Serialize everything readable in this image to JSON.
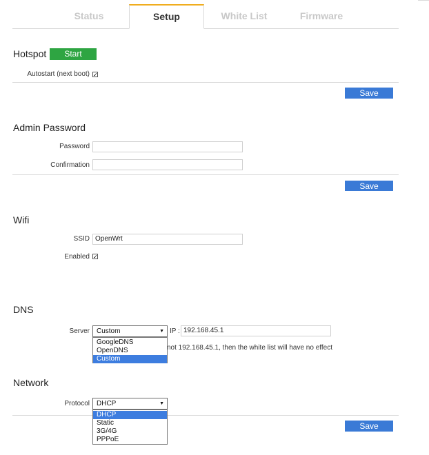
{
  "tabs": [
    {
      "label": "Status",
      "active": false
    },
    {
      "label": "Setup",
      "active": true
    },
    {
      "label": "White List",
      "active": false
    },
    {
      "label": "Firmware",
      "active": false
    }
  ],
  "hotspot": {
    "title": "Hotspot",
    "start_label": "Start",
    "autostart_label": "Autostart (next boot)",
    "autostart_checked": true,
    "save_label": "Save"
  },
  "admin_password": {
    "title": "Admin Password",
    "password_label": "Password",
    "password_value": "",
    "confirmation_label": "Confirmation",
    "confirmation_value": "",
    "save_label": "Save"
  },
  "wifi": {
    "title": "Wifi",
    "ssid_label": "SSID",
    "ssid_value": "OpenWrt",
    "enabled_label": "Enabled",
    "enabled_checked": true
  },
  "dns": {
    "title": "DNS",
    "server_label": "Server",
    "server_selected": "Custom",
    "server_options": [
      "GoogleDNS",
      "OpenDNS",
      "Custom"
    ],
    "ip_label": "IP :",
    "ip_value": "192.168.45.1",
    "note_visible": "not 192.168.45.1, then the white list will have no effect"
  },
  "network": {
    "title": "Network",
    "protocol_label": "Protocol",
    "protocol_selected": "DHCP",
    "protocol_options": [
      "DHCP",
      "Static",
      "3G/4G",
      "PPPoE"
    ],
    "save_label": "Save"
  },
  "colors": {
    "start_button": "#2ea542",
    "save_button": "#3a7ad6",
    "active_tab_accent": "#f0ad1e",
    "selected_option": "#3d7ddf"
  }
}
